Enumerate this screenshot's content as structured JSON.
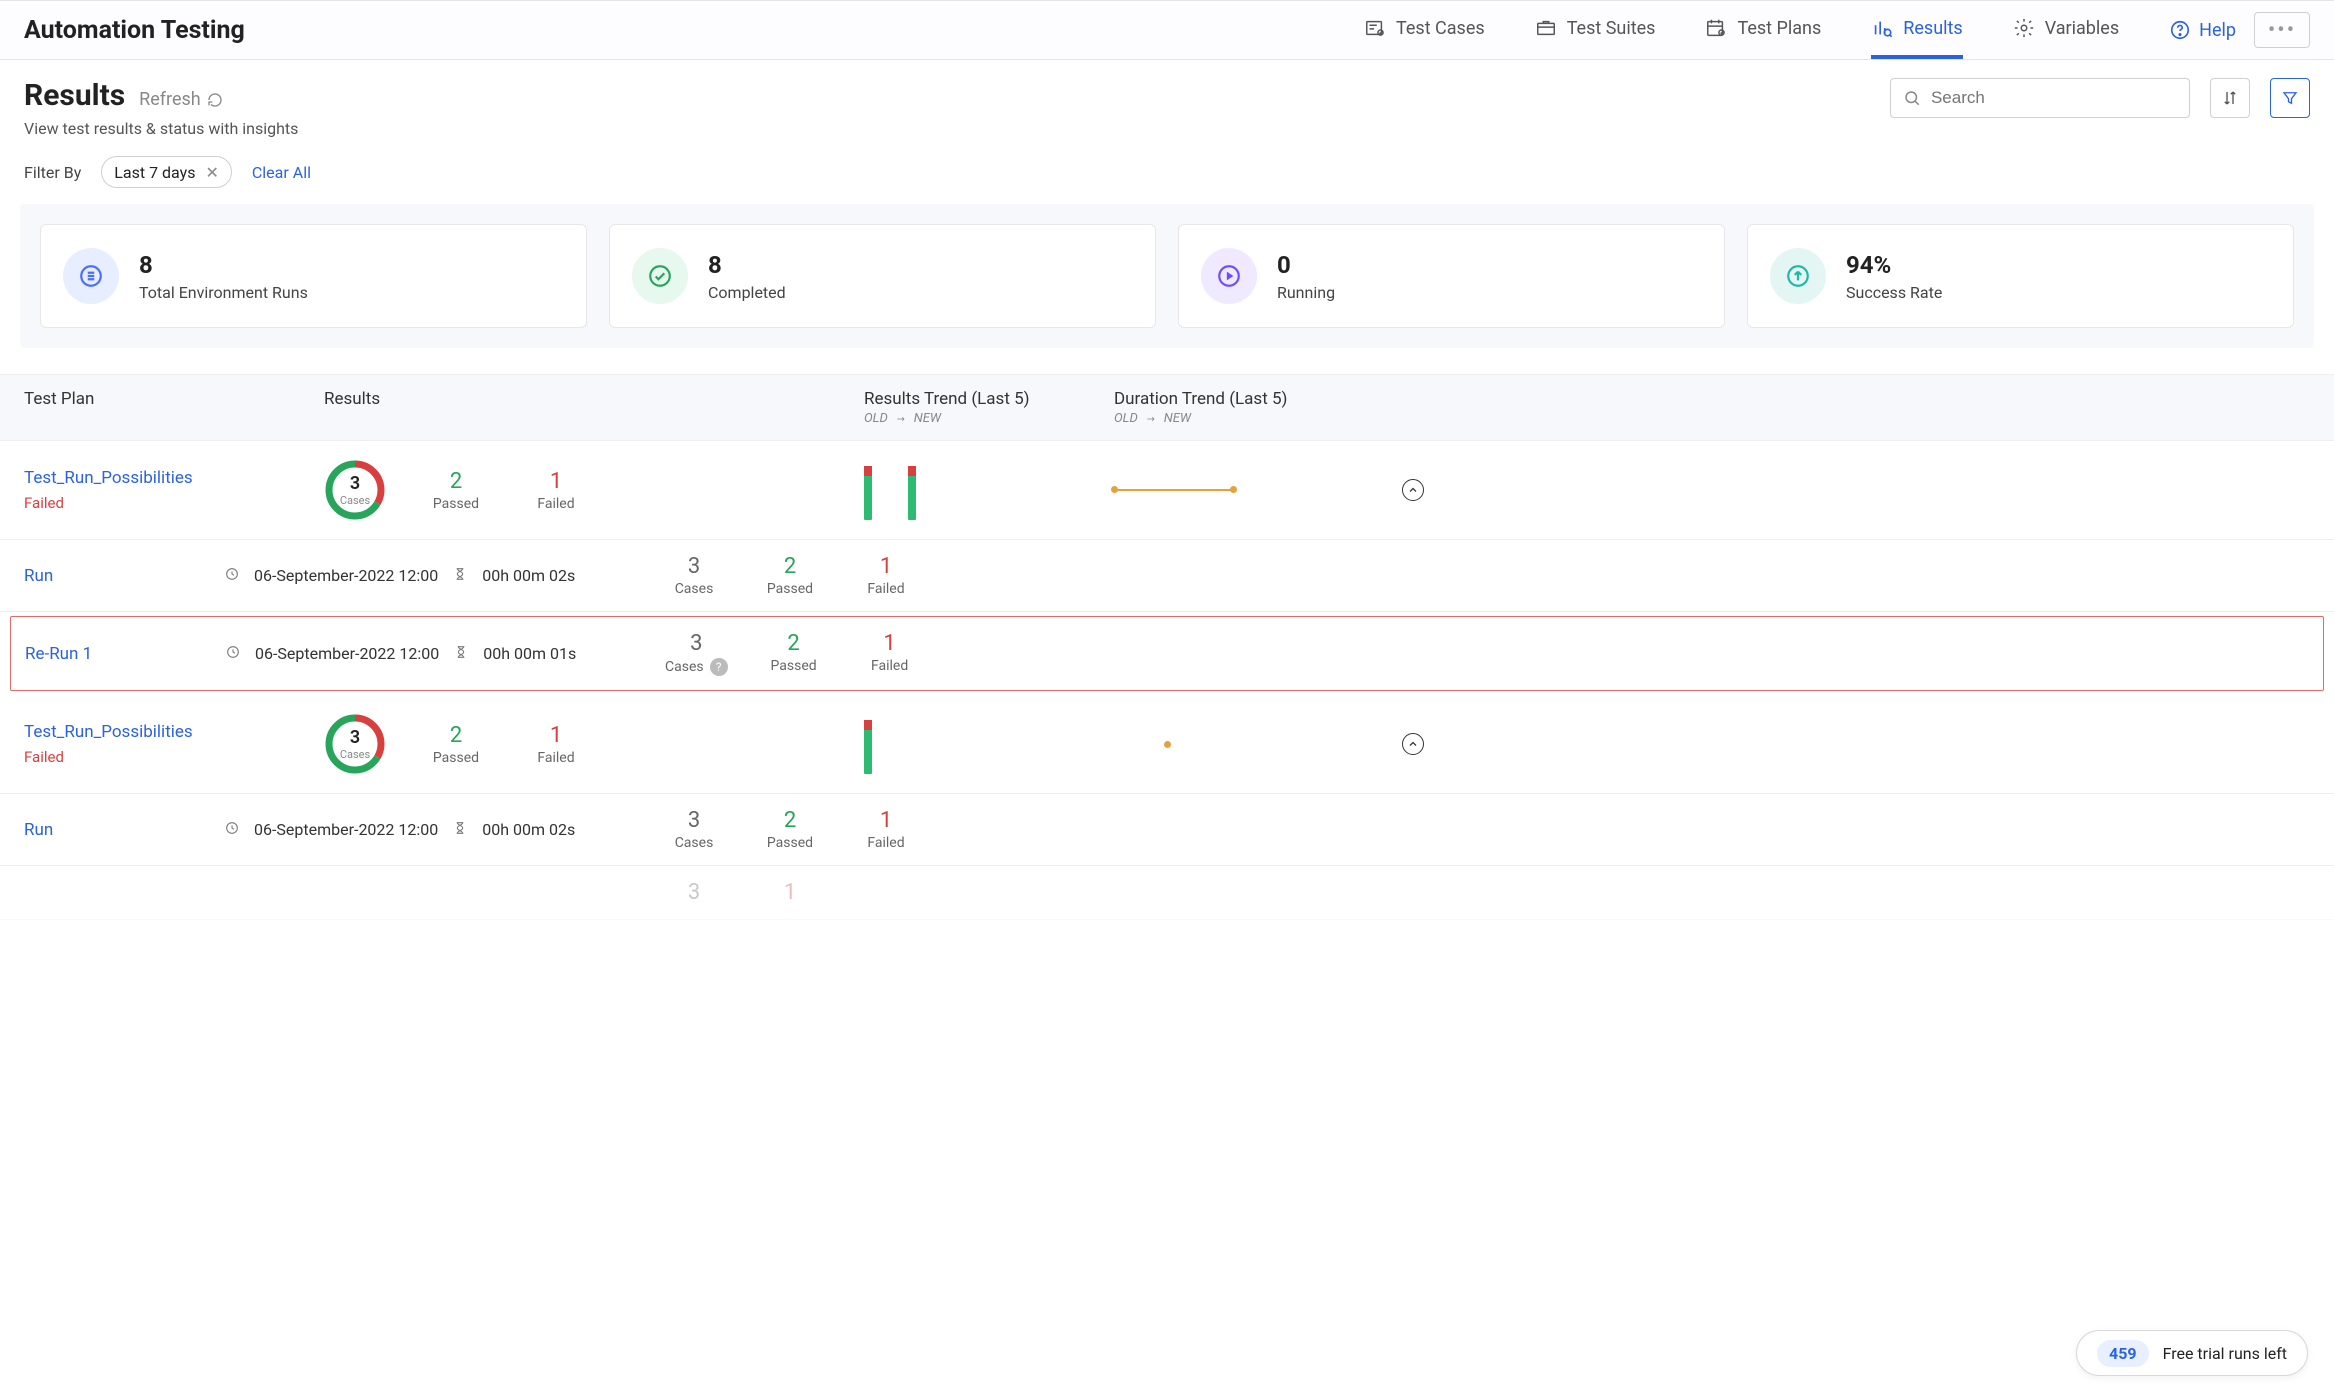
{
  "header": {
    "app_title": "Automation Testing",
    "tabs": [
      {
        "label": "Test Cases"
      },
      {
        "label": "Test Suites"
      },
      {
        "label": "Test Plans"
      },
      {
        "label": "Results",
        "active": true
      },
      {
        "label": "Variables"
      }
    ],
    "help_label": "Help"
  },
  "page": {
    "title": "Results",
    "refresh_label": "Refresh",
    "subtitle": "View test results & status with insights",
    "search_placeholder": "Search"
  },
  "filter": {
    "label": "Filter By",
    "chip": "Last 7 days",
    "clear_label": "Clear All"
  },
  "stats": {
    "total_runs": {
      "value": "8",
      "label": "Total Environment Runs"
    },
    "completed": {
      "value": "8",
      "label": "Completed"
    },
    "running": {
      "value": "0",
      "label": "Running"
    },
    "success_rate": {
      "value": "94%",
      "label": "Success Rate"
    }
  },
  "columns": {
    "plan": "Test Plan",
    "results": "Results",
    "results_trend": "Results Trend (Last 5)",
    "duration_trend": "Duration Trend (Last 5)",
    "old": "OLD",
    "new": "NEW"
  },
  "labels": {
    "cases": "Cases",
    "passed": "Passed",
    "failed": "Failed"
  },
  "rows": [
    {
      "name": "Test_Run_Possibilities",
      "status": "Failed",
      "cases": "3",
      "passed": "2",
      "failed": "1",
      "trend_bars": 2,
      "dur_trend_type": "line",
      "subruns": [
        {
          "name": "Run",
          "date": "06-September-2022 12:00",
          "duration": "00h 00m 02s",
          "cases": "3",
          "passed": "2",
          "failed": "1",
          "highlight": false,
          "cases_help": false
        },
        {
          "name": "Re-Run 1",
          "date": "06-September-2022 12:00",
          "duration": "00h 00m 01s",
          "cases": "3",
          "passed": "2",
          "failed": "1",
          "highlight": true,
          "cases_help": true
        }
      ]
    },
    {
      "name": "Test_Run_Possibilities",
      "status": "Failed",
      "cases": "3",
      "passed": "2",
      "failed": "1",
      "trend_bars": 1,
      "dur_trend_type": "dot",
      "subruns": [
        {
          "name": "Run",
          "date": "06-September-2022 12:00",
          "duration": "00h 00m 02s",
          "cases": "3",
          "passed": "2",
          "failed": "1",
          "highlight": false,
          "cases_help": false
        }
      ]
    }
  ],
  "trial": {
    "count": "459",
    "label": "Free trial runs left"
  },
  "chart_data": {
    "stats": {
      "total_runs": 8,
      "completed": 8,
      "running": 0,
      "success_rate_pct": 94
    },
    "donuts": [
      {
        "title": "Test_Run_Possibilities",
        "type": "pie",
        "series": [
          {
            "name": "Passed",
            "value": 2
          },
          {
            "name": "Failed",
            "value": 1
          }
        ],
        "total_cases": 3
      },
      {
        "title": "Test_Run_Possibilities",
        "type": "pie",
        "series": [
          {
            "name": "Passed",
            "value": 2
          },
          {
            "name": "Failed",
            "value": 1
          }
        ],
        "total_cases": 3
      }
    ],
    "results_trend": [
      {
        "series": [
          {
            "passed": 2,
            "failed": 1
          },
          {
            "passed": 2,
            "failed": 1
          }
        ]
      },
      {
        "series": [
          {
            "passed": 2,
            "failed": 1
          }
        ]
      }
    ],
    "duration_trend": [
      {
        "type": "line",
        "values_seconds": [
          2,
          2
        ]
      },
      {
        "type": "scatter",
        "values_seconds": [
          2
        ]
      }
    ]
  }
}
